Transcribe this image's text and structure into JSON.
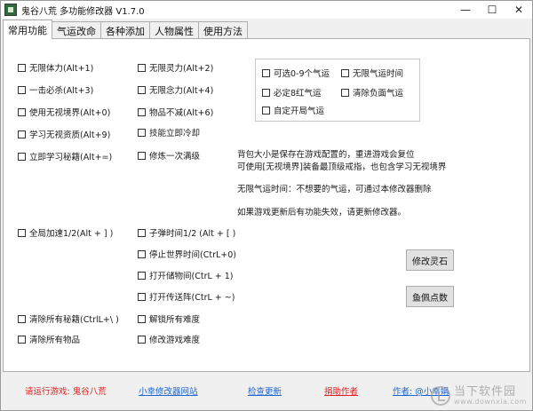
{
  "window": {
    "title": "鬼谷八荒 多功能修改器  V1.7.0",
    "controls": [
      "—",
      "☐",
      "✕"
    ]
  },
  "tabs": [
    "常用功能",
    "气运改命",
    "各种添加",
    "人物属性",
    "使用方法"
  ],
  "col1": [
    "无限体力(Alt+1)",
    "一击必杀(Alt+3)",
    "使用无视境界(Alt+0)",
    "学习无视资质(Alt+9)",
    "立即学习秘籍(Alt+=)",
    "全局加速1/2(Alt + ] )",
    "清除所有秘籍(CtrlL+\\ )",
    "清除所有物品"
  ],
  "col2": [
    "无限灵力(Alt+2)",
    "无限念力(Alt+4)",
    "物品不减(Alt+6)",
    "技能立即冷却",
    "修炼一次满级",
    "子弹时间1/2 (Alt + [ )",
    "停止世界时间(CtrL+0)",
    "打开储物间(CtrL + 1)",
    "打开传送阵(CtrL + ~)",
    "解锁所有难度",
    "修改游戏难度"
  ],
  "fortune": {
    "row1": [
      "可选0-9个气运",
      "无限气运时间"
    ],
    "row2": [
      "必定8红气运",
      "清除负面气运"
    ],
    "row3": [
      "自定开局气运"
    ]
  },
  "info": [
    "背包大小是保存在游戏配置的，重进游戏会复位",
    "可使用[无视境界]装备最顶级戒指，也包含学习无视境界",
    "无限气运时间：不想要的气运，可通过本修改器删除",
    "如果游戏更新后有功能失效，请更新修改器。"
  ],
  "buttons": {
    "stones": "修改灵石",
    "points": "鱼佩点数"
  },
  "footer": {
    "run_prompt": "请运行游戏:  鬼谷八荒",
    "site": "小幸修改器网站",
    "update": "检查更新",
    "donate": "捐助作者",
    "author": "作者: @小幸娟"
  },
  "watermark": {
    "cn": "当下软件园",
    "en": "www.downxia.com"
  }
}
